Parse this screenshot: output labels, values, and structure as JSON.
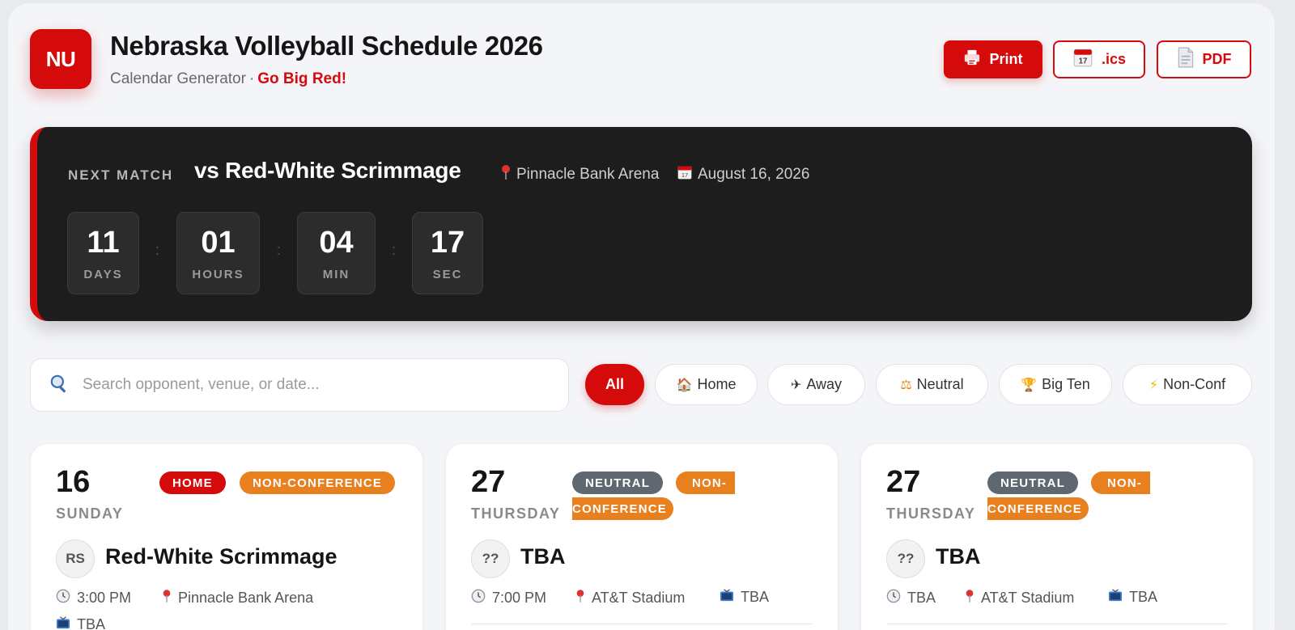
{
  "header": {
    "logo": "NU",
    "title": "Nebraska Volleyball Schedule 2026",
    "subtitle": "Calendar Generator",
    "separator": "·",
    "tagline": "Go Big Red!"
  },
  "actions": {
    "print": "Print",
    "ics": ".ics",
    "pdf": "PDF"
  },
  "next_match": {
    "label": "NEXT MATCH",
    "opponent": "vs Red-White Scrimmage",
    "venue": "Pinnacle Bank Arena",
    "date": "August 16, 2026",
    "countdown": [
      {
        "value": "11",
        "unit": "DAYS"
      },
      {
        "value": "01",
        "unit": "HOURS"
      },
      {
        "value": "04",
        "unit": "MIN"
      },
      {
        "value": "17",
        "unit": "SEC"
      }
    ],
    "separator": ":"
  },
  "search": {
    "placeholder": "Search opponent, venue, or date..."
  },
  "filters": [
    {
      "label": "All",
      "icon": ""
    },
    {
      "label": "Home",
      "icon": "house-icon"
    },
    {
      "label": "Away",
      "icon": "airplane-icon"
    },
    {
      "label": "Neutral",
      "icon": "scales-icon"
    },
    {
      "label": "Big Ten",
      "icon": "trophy-icon"
    },
    {
      "label": "Non-Conf",
      "icon": "lightning-icon"
    }
  ],
  "matches": [
    {
      "day": "16",
      "weekday": "SUNDAY",
      "badges": [
        "HOME",
        "NON-CONFERENCE"
      ],
      "initials": "RS",
      "opponent": "Red-White Scrimmage",
      "time": "3:00 PM",
      "venue": "Pinnacle Bank Arena",
      "tv": "TBA"
    },
    {
      "day": "27",
      "weekday": "THURSDAY",
      "badges": [
        "NEUTRAL",
        "NON-",
        "CONFERENCE"
      ],
      "initials": "??",
      "opponent": "TBA",
      "time": "7:00 PM",
      "venue": "AT&T Stadium",
      "tv": "TBA"
    },
    {
      "day": "27",
      "weekday": "THURSDAY",
      "badges": [
        "NEUTRAL",
        "NON-",
        "CONFERENCE"
      ],
      "initials": "??",
      "opponent": "TBA",
      "time": "TBA",
      "venue": "AT&T Stadium",
      "tv": "TBA"
    }
  ],
  "colors": {
    "brand_red": "#d50a0a",
    "non_conference_orange": "#e8801f",
    "neutral_gray": "#5f6770",
    "banner_dark": "#1d1d1d"
  }
}
